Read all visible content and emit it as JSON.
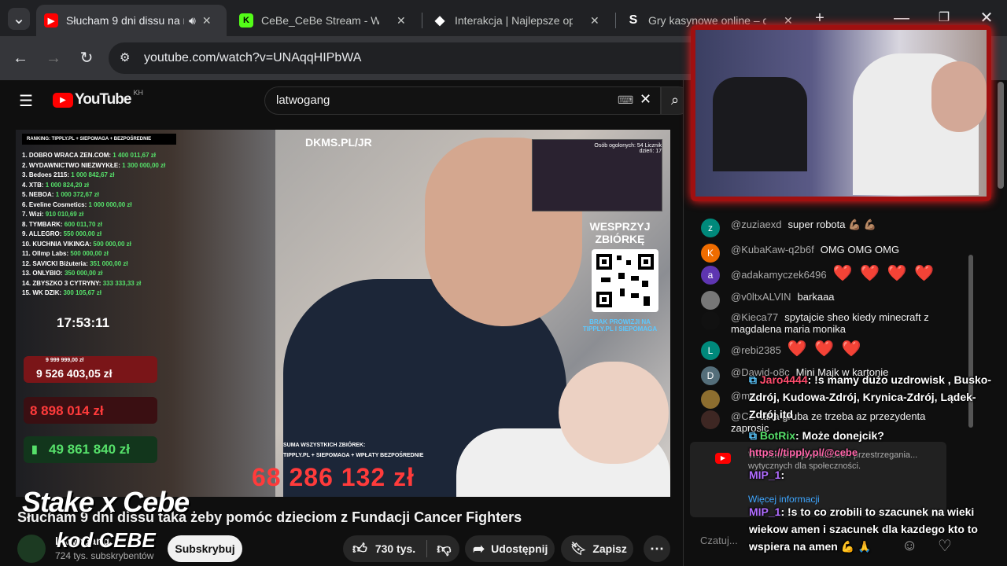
{
  "browser": {
    "tabs": [
      {
        "title": "Słucham 9 dni dissu na r",
        "active": true
      },
      {
        "title": "CeBe_CeBe Stream - Watch L"
      },
      {
        "title": "Interakcja | Najlepsze oprogr"
      },
      {
        "title": "Gry kasynowe online – graj w"
      }
    ],
    "url": "youtube.com/watch?v=UNAqqHIPbWA"
  },
  "youtube": {
    "logo": "YouTube",
    "region": "KH",
    "search_value": "latwogang"
  },
  "video": {
    "ranking_header": "RANKING: TIPPLY.PL + SIEPOMAGA + BEZPOŚREDNIE",
    "ranking": [
      {
        "label": "1. DOBRO WRACA ZEN.COM:",
        "amount": "1 400 011,67 zł"
      },
      {
        "label": "2. WYDAWNICTWO NIEZWYKŁE:",
        "amount": "1 300 000,00 zł"
      },
      {
        "label": "3. Bedoes 2115:",
        "amount": "1 000 842,67 zł"
      },
      {
        "label": "4. XTB:",
        "amount": "1 000 824,20 zł"
      },
      {
        "label": "5. NEBOA:",
        "amount": "1 000 372,67 zł"
      },
      {
        "label": "6. Eveline Cosmetics:",
        "amount": "1 000 000,00 zł"
      },
      {
        "label": "7. Wizi:",
        "amount": "910 010,69 zł"
      },
      {
        "label": "8. TYMBARK:",
        "amount": "600 011,70 zł"
      },
      {
        "label": "9. ALLEGRO:",
        "amount": "550 000,00 zł"
      },
      {
        "label": "10. KUCHNIA VIKINGA:",
        "amount": "500 000,00 zł"
      },
      {
        "label": "11. Ollmp Labs:",
        "amount": "500 000,00 zł"
      },
      {
        "label": "12. SAVICKI Biżuteria:",
        "amount": "351 000,00 zł"
      },
      {
        "label": "13. ONLYBIO:",
        "amount": "350 000,00 zł"
      },
      {
        "label": "14. ZBYSZKO 3 CYTRYNY:",
        "amount": "333 333,33 zł"
      },
      {
        "label": "15. WK DZIK:",
        "amount": "300 105,67 zł"
      }
    ],
    "timer": "17:53:11",
    "box1_small": "9 999 999,00 zł",
    "box1": "9 526 403,05 zł",
    "box2": "8 898 014 zł",
    "box3": "49 861 840 zł",
    "dkms": "DKMS.PL/JR",
    "wesprzyj": "WESPRZYJ ZBIÓRKĘ",
    "brak": "BRAK PROWIZJI NA TIPPLY.PL I SIEPOMAGA",
    "inset_text": "Osób ogolonych: 54  Licznik dzień: 17",
    "suma_label": "SUMA WSZYSTKICH ZBIÓREK:",
    "suma_sub": "TIPPLY.PL + SIEPOMAGA + WPŁATY BEZPOŚREDNIE",
    "total": "68 286 132 zł"
  },
  "meta": {
    "title": "Słucham 9 dni dissu taka żeby pomóc dzieciom z Fundacji Cancer Fighters",
    "channel": "latwogang",
    "subs": "724 tys. subskrybentów",
    "subscribe": "Subskrybuj",
    "likes": "730 tys.",
    "share": "Udostępnij",
    "save": "Zapisz",
    "watermark": "Stake x Cebe",
    "watermark_code": "kod CEBE"
  },
  "chat": {
    "messages": [
      {
        "author": "@zuziaexd",
        "text": "super robota 💪🏽 💪🏽",
        "avatar": "z",
        "color": "#00897b"
      },
      {
        "author": "@KubaKaw-q2b6f",
        "text": "OMG OMG OMG",
        "avatar": "K",
        "color": "#ef6c00"
      },
      {
        "author": "@adakamyczek6496",
        "text": "❤️ ❤️ ❤️ ❤️",
        "avatar": "a",
        "color": "#5e35b1",
        "hearts": true
      },
      {
        "author": "@v0ltxALVIN",
        "text": "barkaaa",
        "avatar": "",
        "color": "#777"
      },
      {
        "author": "@Kieca77",
        "text": "spytajcie sheo kiedy minecraft z magdalena maria monika",
        "avatar": "",
        "color": "#111"
      },
      {
        "author": "@rebi2385",
        "text": "❤️ ❤️ ❤️",
        "avatar": "L",
        "color": "#00897b",
        "hearts": true
      },
      {
        "author": "@Dawid-o8c",
        "text": "Mini Majk w kartonie",
        "avatar": "D",
        "color": "#546e7a"
      },
      {
        "author": "@ma",
        "text": "",
        "avatar": "",
        "color": "#8d6e2f"
      },
      {
        "author": "@Cz",
        "text": "taka gruba ze trzeba az przezydenta zaprosic",
        "avatar": "",
        "color": "#3e2723"
      }
    ],
    "notice": "W... ochronie prywatności i przestrzegania... wytycznych dla społeczności.",
    "notice_link": "Więcej informacji",
    "input_placeholder": "Czatuj..."
  },
  "overlay": {
    "m1_name": "Jaro4444",
    "m1_text": ": !s mamy dużo uzdrowisk , Busko-Zdrój, Kudowa-Zdrój, Krynica-Zdrój, Lądek-Zdrój itd",
    "m2_name": "BotRix",
    "m2_text": ": Może donejcik?",
    "m2_link": "https://tipply.pl/@cebe",
    "m3_name": "MIP_1",
    "m3_text": ":",
    "m4_name": "MIP_1",
    "m4_text": ": !s to co zrobili to szacunek na wieki wiekow amen i szacunek dla kazdego kto to wspiera na amen 💪 🙏"
  }
}
